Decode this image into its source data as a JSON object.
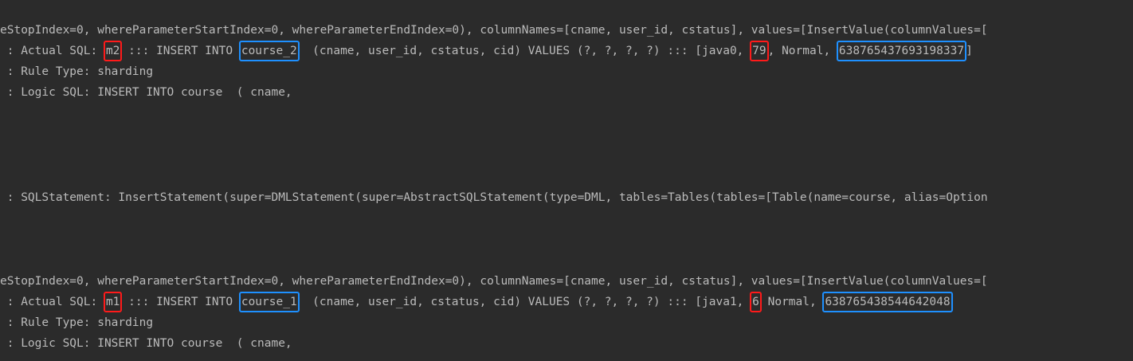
{
  "colors": {
    "background": "#2b2b2b",
    "text": "#bbbbbb",
    "red_highlight": "#ff1a1a",
    "blue_highlight": "#1e90ff"
  },
  "block1": {
    "l1": "eStopIndex=0, whereParameterStartIndex=0, whereParameterEndIndex=0), columnNames=[cname, user_id, cstatus], values=[InsertValue(columnValues=[",
    "l2_prefix": " : Actual SQL:",
    "l2_ds": "m2",
    "l2_mid": "::: INSERT INTO",
    "l2_table": "course_2",
    "l2_after_table": "(cname, user_id, cstatus, cid) VALUES (?, ?, ?, ?) ::: [java0,",
    "l2_uid": "79",
    "l2_status": ", Normal,",
    "l2_cid": "638765437693198337",
    "l2_end": "]",
    "l3": " : Rule Type: sharding",
    "l4": " : Logic SQL: INSERT INTO course  ( cname,"
  },
  "middle": {
    "l1": " : SQLStatement: InsertStatement(super=DMLStatement(super=AbstractSQLStatement(type=DML, tables=Tables(tables=[Table(name=course, alias=Option"
  },
  "block2": {
    "l1": "eStopIndex=0, whereParameterStartIndex=0, whereParameterEndIndex=0), columnNames=[cname, user_id, cstatus], values=[InsertValue(columnValues=[",
    "l2_prefix": " : Actual SQL:",
    "l2_ds": "m1",
    "l2_mid": "::: INSERT INTO",
    "l2_table": "course_1",
    "l2_after_table": "(cname, user_id, cstatus, cid) VALUES (?, ?, ?, ?) ::: [java1,",
    "l2_uid": "6",
    "l2_status": " Normal,",
    "l2_cid": "638765438544642048",
    "l3": " : Rule Type: sharding",
    "l4": " : Logic SQL: INSERT INTO course  ( cname,"
  }
}
